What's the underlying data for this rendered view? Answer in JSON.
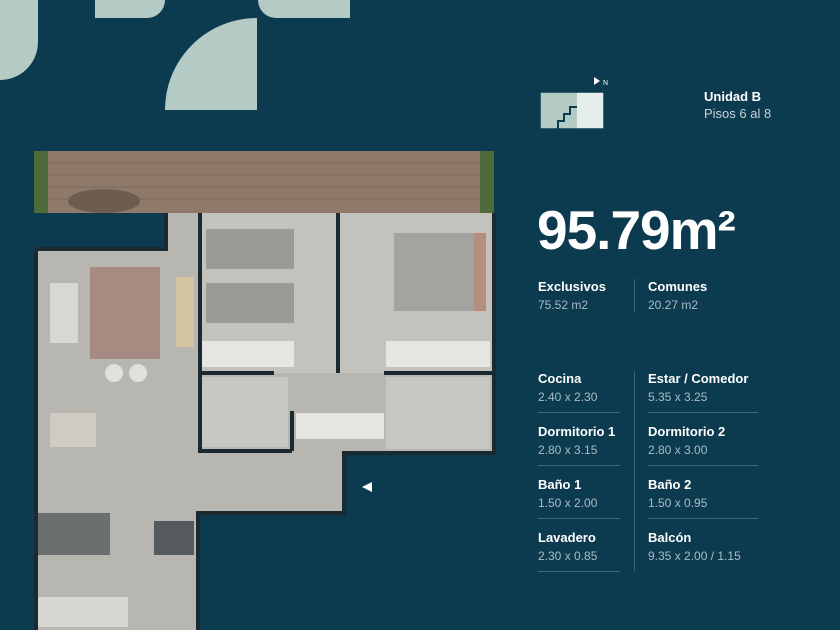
{
  "unit": {
    "title": "Unidad B",
    "floors": "Pisos 6 al 8",
    "compass": "N"
  },
  "area": {
    "total": "95.79m²"
  },
  "summary": [
    {
      "label": "Exclusivos",
      "value": "75.52 m2"
    },
    {
      "label": "Comunes",
      "value": "20.27 m2"
    }
  ],
  "rooms": [
    {
      "label": "Cocina",
      "value": "2.40 x 2.30"
    },
    {
      "label": "Estar / Comedor",
      "value": "5.35 x 3.25"
    },
    {
      "label": "Dormitorio 1",
      "value": "2.80 x 3.15"
    },
    {
      "label": "Dormitorio 2",
      "value": "2.80 x 3.00"
    },
    {
      "label": "Baño 1",
      "value": "1.50 x 2.00"
    },
    {
      "label": "Baño 2",
      "value": "1.50 x 0.95"
    },
    {
      "label": "Lavadero",
      "value": "2.30 x 0.85"
    },
    {
      "label": "Balcón",
      "value": "9.35 x 2.00 / 1.15"
    }
  ],
  "colors": {
    "background": "#0c3a4e",
    "accent": "#b4cac4",
    "floor": "#b9b7b2",
    "deck": "#8a7565"
  }
}
